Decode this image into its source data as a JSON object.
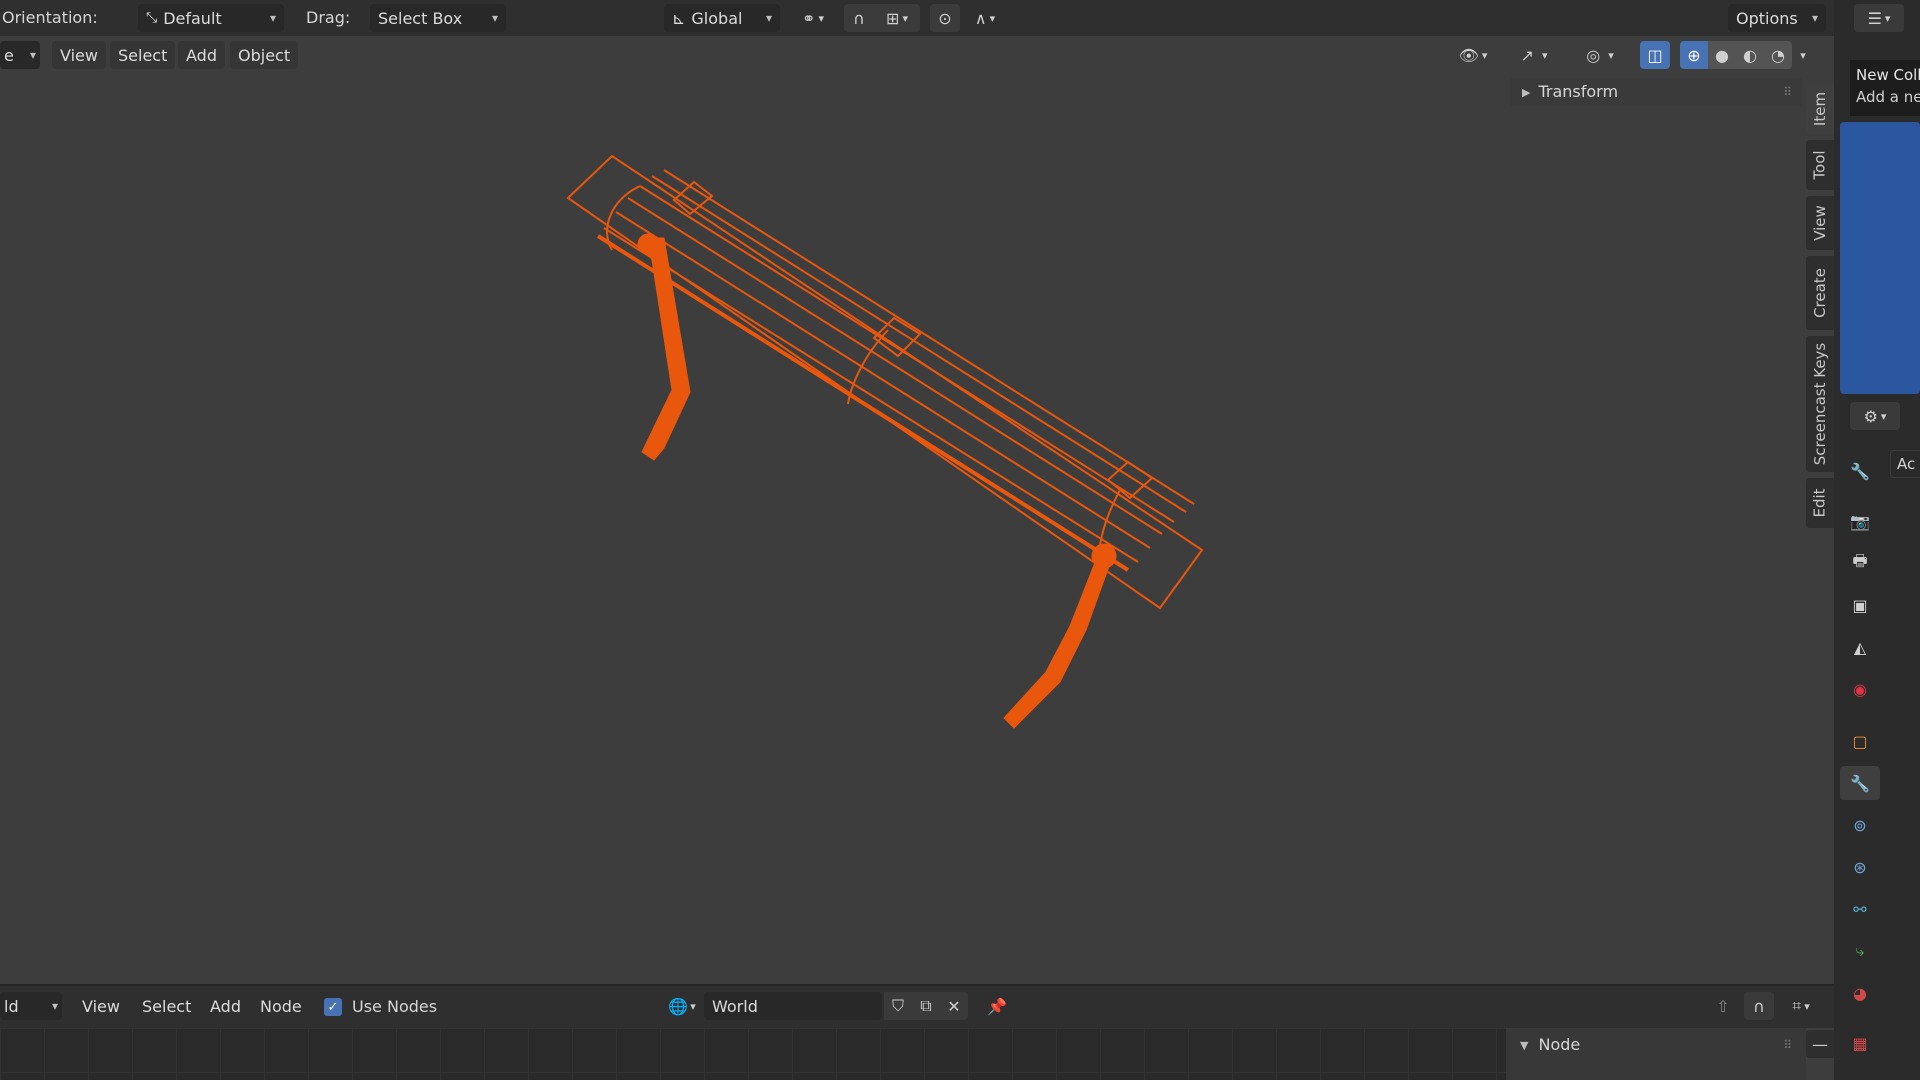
{
  "header": {
    "orientation_label": "Orientation:",
    "orientation_value": "Default",
    "drag_label": "Drag:",
    "drag_value": "Select Box",
    "transform_orientation": "Global",
    "options_label": "Options"
  },
  "viewport_menu": {
    "mode_fragment": "e",
    "items": [
      "View",
      "Select",
      "Add",
      "Object"
    ]
  },
  "npanel": {
    "section": "Transform",
    "tabs": [
      "Item",
      "Tool",
      "View",
      "Create",
      "Screencast Keys",
      "Edit"
    ]
  },
  "right_panel": {
    "tooltip_line1": "New Coll",
    "tooltip_line2": "Add a ne",
    "props_fragment": "Ac"
  },
  "node_editor": {
    "editor_fragment": "ld",
    "menu": [
      "View",
      "Select",
      "Add",
      "Node"
    ],
    "use_nodes_label": "Use Nodes",
    "use_nodes_checked": true,
    "world_name": "World",
    "sidebar_section": "Node"
  },
  "colors": {
    "selection": "#e8570c",
    "outliner_highlight": "#2b56a0",
    "accent": "#4772b3"
  },
  "icons": [
    "transform-orientation-icon",
    "global-axes-icon",
    "pivot-icon",
    "snap-magnet-icon",
    "snap-increment-icon",
    "proportional-edit-icon",
    "falloff-icon",
    "visibility-eye-icon",
    "gizmo-icon",
    "overlay-icon",
    "xray-icon",
    "wireframe-shading-icon",
    "solid-shading-icon",
    "material-shading-icon",
    "rendered-shading-icon",
    "editor-type-icon",
    "tool-properties-icon",
    "render-properties-icon",
    "output-properties-icon",
    "view-layer-icon",
    "scene-icon",
    "world-icon",
    "object-properties-icon",
    "modifier-wrench-icon",
    "particles-icon",
    "physics-icon",
    "constraints-icon",
    "data-icon",
    "material-icon",
    "texture-icon",
    "world-browse-icon",
    "fake-user-shield-icon",
    "duplicate-icon",
    "unlink-x-icon",
    "pin-icon",
    "parent-arrow-icon",
    "node-snap-icon",
    "node-grid-icon"
  ]
}
